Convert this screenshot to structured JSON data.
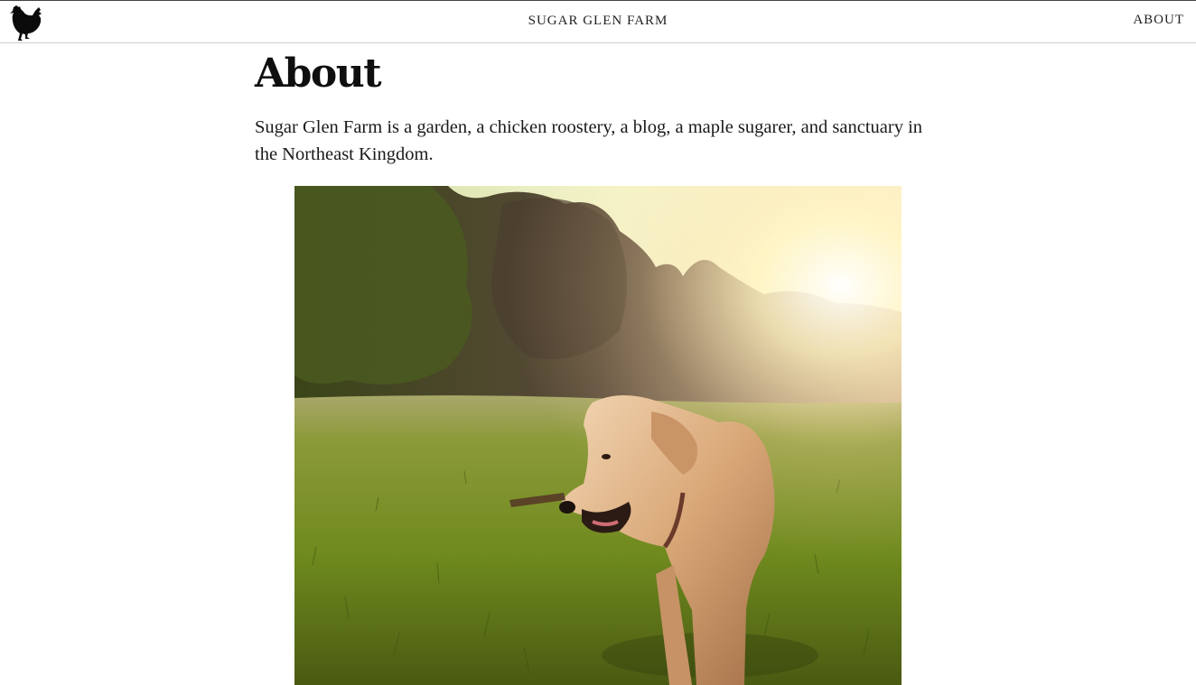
{
  "header": {
    "site_title": "SUGAR GLEN FARM",
    "nav": [
      {
        "label": "ABOUT"
      }
    ],
    "logo_icon": "chicken-silhouette-icon"
  },
  "main": {
    "title": "About",
    "intro": "Sugar Glen Farm is a garden, a chicken roostery, a blog, a maple sugarer, and sanctuary in the Northeast Kingdom."
  },
  "colors": {
    "text": "#111111",
    "header_border": "#cfcfcf",
    "grass": "#6f8a1e",
    "sun_glow": "#fff6c8"
  }
}
